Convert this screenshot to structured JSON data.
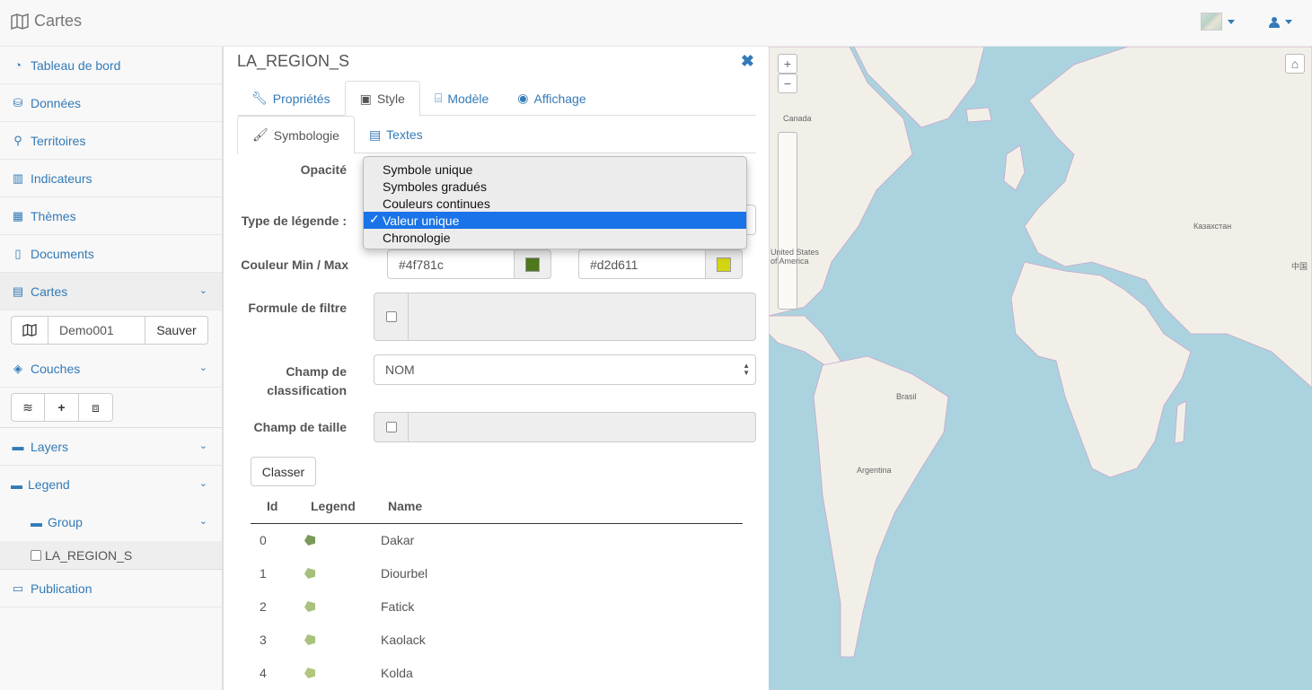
{
  "navbar": {
    "title": "Cartes",
    "user_icon": "user-icon",
    "basemap_icon": "basemap-thumbnail"
  },
  "sidebar": {
    "items": [
      {
        "label": "Tableau de bord",
        "icon": "dashboard-icon"
      },
      {
        "label": "Données",
        "icon": "database-icon"
      },
      {
        "label": "Territoires",
        "icon": "sitemap-icon"
      },
      {
        "label": "Indicateurs",
        "icon": "bar-chart-icon"
      },
      {
        "label": "Thèmes",
        "icon": "grid-icon"
      },
      {
        "label": "Documents",
        "icon": "file-icon"
      },
      {
        "label": "Cartes",
        "icon": "map-icon"
      }
    ],
    "map_name": "Demo001",
    "save_label": "Sauver",
    "couches_label": "Couches",
    "layers_label": "Layers",
    "legend_label": "Legend",
    "group_label": "Group",
    "layer_item": "LA_REGION_S",
    "publication_label": "Publication"
  },
  "panel": {
    "title": "LA_REGION_S",
    "tabs": [
      {
        "label": "Propriétés"
      },
      {
        "label": "Style"
      },
      {
        "label": "Modèle"
      },
      {
        "label": "Affichage"
      }
    ],
    "subtabs": [
      {
        "label": "Symbologie"
      },
      {
        "label": "Textes"
      }
    ],
    "opacity_label": "Opacité",
    "legend_type_label": "Type de légende :",
    "color_label": "Couleur Min / Max",
    "color_min": "#4f781c",
    "color_max": "#d2d611",
    "filter_label": "Formule de filtre",
    "classif_label_1": "Champ de",
    "classif_label_2": "classification",
    "classif_value": "NOM",
    "size_label": "Champ de taille",
    "classer_label": "Classer",
    "table": {
      "headers": [
        "Id",
        "Legend",
        "Name"
      ],
      "rows": [
        {
          "id": "0",
          "name": "Dakar",
          "color": "#7a9a5a"
        },
        {
          "id": "1",
          "name": "Diourbel",
          "color": "#a4c07c"
        },
        {
          "id": "2",
          "name": "Fatick",
          "color": "#a8c17e"
        },
        {
          "id": "3",
          "name": "Kaolack",
          "color": "#a9c27c"
        },
        {
          "id": "4",
          "name": "Kolda",
          "color": "#b1c57d"
        }
      ]
    }
  },
  "dropdown": {
    "options": [
      "Symbole unique",
      "Symboles gradués",
      "Couleurs continues",
      "Valeur unique",
      "Chronologie"
    ],
    "selected": "Valeur unique",
    "check": "✓"
  },
  "map": {
    "labels": {
      "canada": "Canada",
      "usa1": "United States",
      "usa2": "of America",
      "brasil": "Brasil",
      "argentina": "Argentina",
      "kazakhstan": "Казахстан",
      "china": "中国"
    },
    "zoom_in": "+",
    "zoom_out": "−"
  }
}
